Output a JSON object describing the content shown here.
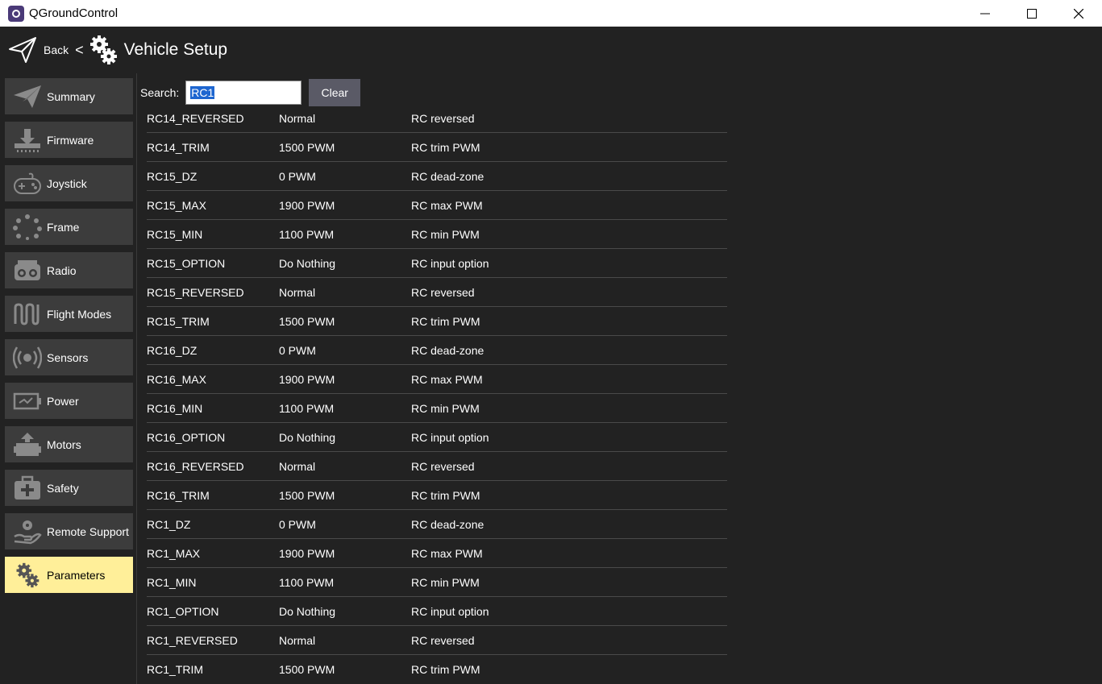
{
  "window": {
    "title": "QGroundControl"
  },
  "header": {
    "back_label": "Back",
    "separator": "<",
    "title": "Vehicle Setup"
  },
  "sidebar": {
    "items": [
      {
        "label": "Summary",
        "icon": "plane-icon"
      },
      {
        "label": "Firmware",
        "icon": "download-icon"
      },
      {
        "label": "Joystick",
        "icon": "gamepad-icon"
      },
      {
        "label": "Frame",
        "icon": "frame-dots-icon"
      },
      {
        "label": "Radio",
        "icon": "radio-icon"
      },
      {
        "label": "Flight Modes",
        "icon": "wave-icon"
      },
      {
        "label": "Sensors",
        "icon": "sensor-icon"
      },
      {
        "label": "Power",
        "icon": "battery-icon"
      },
      {
        "label": "Motors",
        "icon": "motor-icon"
      },
      {
        "label": "Safety",
        "icon": "first-aid-icon"
      },
      {
        "label": "Remote Support",
        "icon": "support-hand-icon"
      },
      {
        "label": "Parameters",
        "icon": "gears-icon",
        "active": true
      }
    ]
  },
  "search": {
    "label": "Search:",
    "value": "RC1",
    "clear_label": "Clear"
  },
  "params": [
    {
      "name": "RC14_REVERSED",
      "value": "Normal",
      "desc": "RC reversed"
    },
    {
      "name": "RC14_TRIM",
      "value": "1500 PWM",
      "desc": "RC trim PWM"
    },
    {
      "name": "RC15_DZ",
      "value": "0 PWM",
      "desc": "RC dead-zone"
    },
    {
      "name": "RC15_MAX",
      "value": "1900 PWM",
      "desc": "RC max PWM"
    },
    {
      "name": "RC15_MIN",
      "value": "1100 PWM",
      "desc": "RC min PWM"
    },
    {
      "name": "RC15_OPTION",
      "value": "Do Nothing",
      "desc": "RC input option"
    },
    {
      "name": "RC15_REVERSED",
      "value": "Normal",
      "desc": "RC reversed"
    },
    {
      "name": "RC15_TRIM",
      "value": "1500 PWM",
      "desc": "RC trim PWM"
    },
    {
      "name": "RC16_DZ",
      "value": "0 PWM",
      "desc": "RC dead-zone"
    },
    {
      "name": "RC16_MAX",
      "value": "1900 PWM",
      "desc": "RC max PWM"
    },
    {
      "name": "RC16_MIN",
      "value": "1100 PWM",
      "desc": "RC min PWM"
    },
    {
      "name": "RC16_OPTION",
      "value": "Do Nothing",
      "desc": "RC input option"
    },
    {
      "name": "RC16_REVERSED",
      "value": "Normal",
      "desc": "RC reversed"
    },
    {
      "name": "RC16_TRIM",
      "value": "1500 PWM",
      "desc": "RC trim PWM"
    },
    {
      "name": "RC1_DZ",
      "value": "0 PWM",
      "desc": "RC dead-zone"
    },
    {
      "name": "RC1_MAX",
      "value": "1900 PWM",
      "desc": "RC max PWM"
    },
    {
      "name": "RC1_MIN",
      "value": "1100 PWM",
      "desc": "RC min PWM"
    },
    {
      "name": "RC1_OPTION",
      "value": "Do Nothing",
      "desc": "RC input option"
    },
    {
      "name": "RC1_REVERSED",
      "value": "Normal",
      "desc": "RC reversed"
    },
    {
      "name": "RC1_TRIM",
      "value": "1500 PWM",
      "desc": "RC trim PWM"
    }
  ],
  "colors": {
    "background": "#222222",
    "sidebar_item": "#3c3c3c",
    "active_item": "#ffef99",
    "clear_button": "#5a5a66",
    "selection": "#1e66d0"
  }
}
